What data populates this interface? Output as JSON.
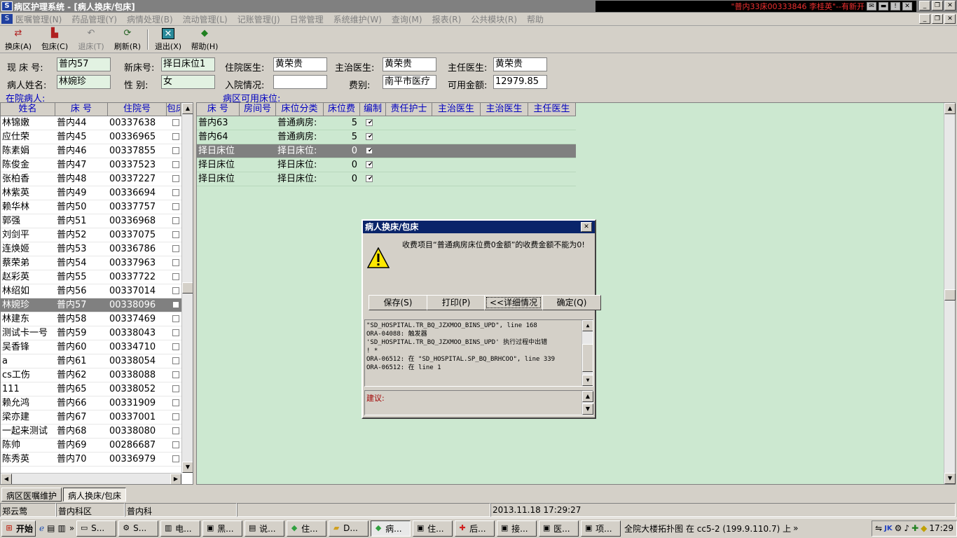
{
  "window": {
    "title": "病区护理系统 - [病人换床/包床]"
  },
  "ticker": {
    "text": "\"普内33床00333846 李桂英\"--有新开"
  },
  "menu": [
    "医嘱管理(N)",
    "药品管理(Y)",
    "病情处理(B)",
    "流动管理(L)",
    "记账管理(J)",
    "日常管理",
    "系统维护(W)",
    "查询(M)",
    "报表(R)",
    "公共模块(R)",
    "帮助"
  ],
  "toolbar": [
    {
      "label": "换床(A)",
      "icon": "bed-swap-icon",
      "enabled": true
    },
    {
      "label": "包床(C)",
      "icon": "bed-book-icon",
      "enabled": true
    },
    {
      "label": "退床(T)",
      "icon": "bed-return-icon",
      "enabled": false
    },
    {
      "label": "刷新(R)",
      "icon": "refresh-icon",
      "enabled": true
    },
    {
      "label": "退出(X)",
      "icon": "exit-icon",
      "enabled": true
    },
    {
      "label": "帮助(H)",
      "icon": "help-book-icon",
      "enabled": true
    }
  ],
  "form": {
    "cur_bed_label": "现 床 号:",
    "cur_bed": "普内57",
    "new_bed_label": "新床号:",
    "new_bed": "择日床位1",
    "inpatient_doctor_label": "住院医生:",
    "inpatient_doctor": "黄荣贵",
    "attending_label": "主治医生:",
    "attending": "黄荣贵",
    "chief_label": "主任医生:",
    "chief": "黄荣贵",
    "name_label": "病人姓名:",
    "name": "林婉珍",
    "gender_label": "性  别:",
    "gender": "女",
    "admission_label": "入院情况:",
    "admission": "",
    "fee_type_label": "费别:",
    "fee_type": "南平市医疗",
    "balance_label": "可用金额:",
    "balance": "12979.85"
  },
  "patients": {
    "section_label": "在院病人:",
    "headers": [
      "姓名",
      "床  号",
      "住院号",
      "包床"
    ],
    "rows": [
      [
        "林锦嫩",
        "普内44",
        "00337638"
      ],
      [
        "应仕荣",
        "普内45",
        "00336965"
      ],
      [
        "陈素娟",
        "普内46",
        "00337855"
      ],
      [
        "陈俊金",
        "普内47",
        "00337523"
      ],
      [
        "张柏香",
        "普内48",
        "00337227"
      ],
      [
        "林紫英",
        "普内49",
        "00336694"
      ],
      [
        "赖华林",
        "普内50",
        "00337757"
      ],
      [
        "郭强",
        "普内51",
        "00336968"
      ],
      [
        "刘剑平",
        "普内52",
        "00337075"
      ],
      [
        "连焕姬",
        "普内53",
        "00336786"
      ],
      [
        "蔡荣弟",
        "普内54",
        "00337963"
      ],
      [
        "赵彩英",
        "普内55",
        "00337722"
      ],
      [
        "林绍如",
        "普内56",
        "00337014"
      ],
      [
        "林婉珍",
        "普内57",
        "00338096"
      ],
      [
        "林建东",
        "普内58",
        "00337469"
      ],
      [
        "测试卡一号",
        "普内59",
        "00338043"
      ],
      [
        "吴香锋",
        "普内60",
        "00334710"
      ],
      [
        "a",
        "普内61",
        "00338054"
      ],
      [
        "cs工伤",
        "普内62",
        "00338088"
      ],
      [
        "111",
        "普内65",
        "00338052"
      ],
      [
        "赖允鸿",
        "普内66",
        "00331909"
      ],
      [
        "梁亦建",
        "普内67",
        "00337001"
      ],
      [
        "一起来测试",
        "普内68",
        "00338080"
      ],
      [
        "陈帅",
        "普内69",
        "00286687"
      ],
      [
        "陈秀英",
        "普内70",
        "00336979"
      ]
    ],
    "selected_index": 13
  },
  "beds": {
    "section_label": "病区可用床位:",
    "headers": [
      "床  号",
      "房间号",
      "床位分类",
      "床位费",
      "编制",
      "责任护士",
      "主治医生",
      "主治医生",
      "主任医生"
    ],
    "rows": [
      [
        "普内63",
        "",
        "普通病房:",
        "5",
        "✔"
      ],
      [
        "普内64",
        "",
        "普通病房:",
        "5",
        "✔"
      ],
      [
        "择日床位",
        "",
        "择日床位:",
        "0",
        "✔"
      ],
      [
        "择日床位",
        "",
        "择日床位:",
        "0",
        "✔"
      ],
      [
        "择日床位",
        "",
        "择日床位:",
        "0",
        "✔"
      ]
    ],
    "selected_index": 2
  },
  "dialog": {
    "title": "病人换床/包床",
    "message": "收费项目“普通病房床位费0金额”的收费金额不能为0!",
    "buttons": {
      "save": "保存(S)",
      "print": "打印(P)",
      "details": "<<详细情况",
      "ok": "确定(Q)"
    },
    "details": [
      "\"SD_HOSPITAL.TR_BQ_JZXMOO_BINS_UPD\", line 168",
      "ORA-04088: 触发器",
      "'SD_HOSPITAL.TR_BQ_JZXMOO_BINS_UPD' 执行过程中出错",
      "! *",
      "ORA-06512: 在 \"SD_HOSPITAL.SP_BQ_BRHCOO\", line 339",
      "ORA-06512: 在 line 1"
    ],
    "suggestion_label": "建议:"
  },
  "tabs": [
    "病区医嘱维护",
    "病人换床/包床"
  ],
  "status": {
    "user": "郑云莺",
    "ward": "普内科区",
    "dept": "普内科",
    "datetime": "2013.11.18 17:29:27"
  },
  "taskbar": {
    "start": "开始",
    "items": [
      {
        "label": "S...",
        "icon": "monitor-icon"
      },
      {
        "label": "S...",
        "icon": "gear-icon"
      },
      {
        "label": "电...",
        "icon": "book-icon"
      },
      {
        "label": "黑...",
        "icon": "app-icon"
      },
      {
        "label": "说...",
        "icon": "doc-icon"
      },
      {
        "label": "住...",
        "icon": "diamond-icon"
      },
      {
        "label": "D...",
        "icon": "folder-icon"
      },
      {
        "label": "病...",
        "icon": "diamond-icon"
      },
      {
        "label": "住...",
        "icon": "app-icon"
      },
      {
        "label": "后...",
        "icon": "cross-icon"
      },
      {
        "label": "接...",
        "icon": "app-icon"
      },
      {
        "label": "医...",
        "icon": "app-icon"
      },
      {
        "label": "项...",
        "icon": "app-icon"
      }
    ],
    "active_index": 7,
    "notice": "全院大楼拓扑图 在 cc5-2 (199.9.110.7) 上",
    "clock": "17:29"
  }
}
